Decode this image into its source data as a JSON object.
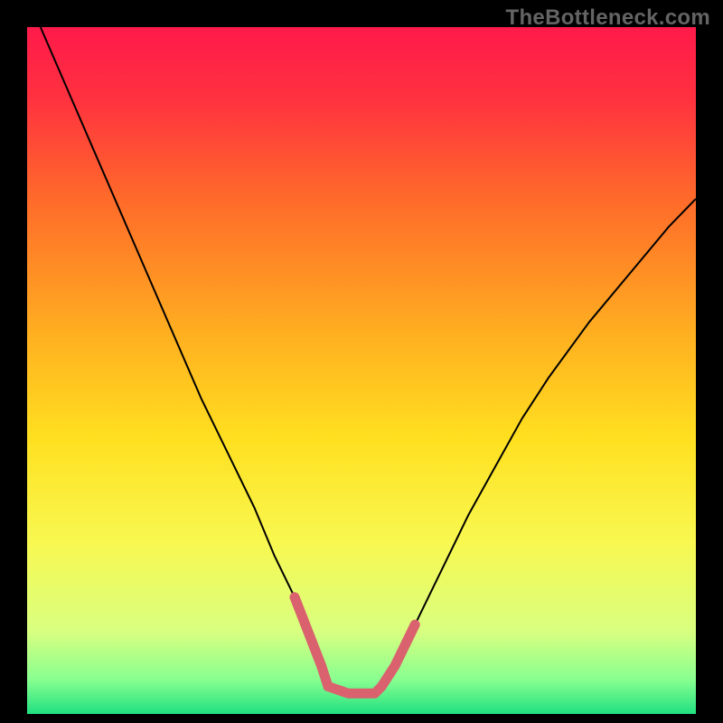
{
  "watermark": "TheBottleneck.com",
  "chart_data": {
    "type": "line",
    "title": "",
    "xlabel": "",
    "ylabel": "",
    "xlim": [
      0,
      100
    ],
    "ylim": [
      0,
      100
    ],
    "grid": false,
    "legend": false,
    "background_gradient": {
      "stops": [
        {
          "offset": 0.0,
          "color": "#ff1a4a"
        },
        {
          "offset": 0.1,
          "color": "#ff3040"
        },
        {
          "offset": 0.25,
          "color": "#ff6a2a"
        },
        {
          "offset": 0.45,
          "color": "#ffb020"
        },
        {
          "offset": 0.6,
          "color": "#ffe020"
        },
        {
          "offset": 0.75,
          "color": "#f8f850"
        },
        {
          "offset": 0.88,
          "color": "#d8ff80"
        },
        {
          "offset": 0.95,
          "color": "#88ff90"
        },
        {
          "offset": 1.0,
          "color": "#20e080"
        }
      ]
    },
    "series": [
      {
        "name": "bottleneck-curve",
        "stroke": "#000000",
        "stroke_width": 2,
        "x": [
          2,
          6,
          10,
          14,
          18,
          22,
          26,
          30,
          34,
          37,
          40,
          42,
          44,
          45,
          48,
          52,
          53,
          55,
          58,
          62,
          66,
          70,
          74,
          78,
          84,
          90,
          96,
          100
        ],
        "values": [
          100,
          91,
          82,
          73,
          64,
          55,
          46,
          38,
          30,
          23,
          17,
          12,
          7,
          4,
          3,
          3,
          4,
          7,
          13,
          21,
          29,
          36,
          43,
          49,
          57,
          64,
          71,
          75
        ]
      },
      {
        "name": "optimal-range-highlight",
        "stroke": "#d9626e",
        "stroke_width": 11,
        "linecap": "round",
        "x": [
          40,
          42,
          44,
          45,
          48,
          52,
          53,
          55,
          58
        ],
        "values": [
          17,
          12,
          7,
          4,
          3,
          3,
          4,
          7,
          13
        ]
      }
    ]
  }
}
